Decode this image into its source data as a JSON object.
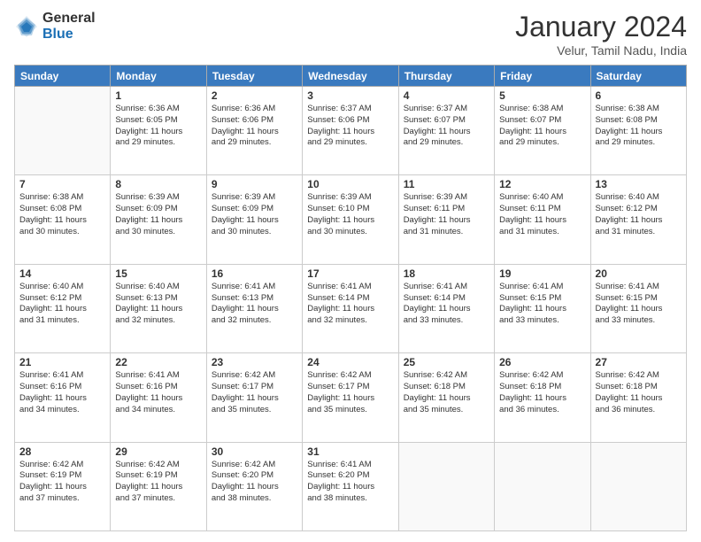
{
  "logo": {
    "general": "General",
    "blue": "Blue"
  },
  "title": "January 2024",
  "subtitle": "Velur, Tamil Nadu, India",
  "weekdays": [
    "Sunday",
    "Monday",
    "Tuesday",
    "Wednesday",
    "Thursday",
    "Friday",
    "Saturday"
  ],
  "weeks": [
    [
      {
        "day": "",
        "info": ""
      },
      {
        "day": "1",
        "info": "Sunrise: 6:36 AM\nSunset: 6:05 PM\nDaylight: 11 hours\nand 29 minutes."
      },
      {
        "day": "2",
        "info": "Sunrise: 6:36 AM\nSunset: 6:06 PM\nDaylight: 11 hours\nand 29 minutes."
      },
      {
        "day": "3",
        "info": "Sunrise: 6:37 AM\nSunset: 6:06 PM\nDaylight: 11 hours\nand 29 minutes."
      },
      {
        "day": "4",
        "info": "Sunrise: 6:37 AM\nSunset: 6:07 PM\nDaylight: 11 hours\nand 29 minutes."
      },
      {
        "day": "5",
        "info": "Sunrise: 6:38 AM\nSunset: 6:07 PM\nDaylight: 11 hours\nand 29 minutes."
      },
      {
        "day": "6",
        "info": "Sunrise: 6:38 AM\nSunset: 6:08 PM\nDaylight: 11 hours\nand 29 minutes."
      }
    ],
    [
      {
        "day": "7",
        "info": "Sunrise: 6:38 AM\nSunset: 6:08 PM\nDaylight: 11 hours\nand 30 minutes."
      },
      {
        "day": "8",
        "info": "Sunrise: 6:39 AM\nSunset: 6:09 PM\nDaylight: 11 hours\nand 30 minutes."
      },
      {
        "day": "9",
        "info": "Sunrise: 6:39 AM\nSunset: 6:09 PM\nDaylight: 11 hours\nand 30 minutes."
      },
      {
        "day": "10",
        "info": "Sunrise: 6:39 AM\nSunset: 6:10 PM\nDaylight: 11 hours\nand 30 minutes."
      },
      {
        "day": "11",
        "info": "Sunrise: 6:39 AM\nSunset: 6:11 PM\nDaylight: 11 hours\nand 31 minutes."
      },
      {
        "day": "12",
        "info": "Sunrise: 6:40 AM\nSunset: 6:11 PM\nDaylight: 11 hours\nand 31 minutes."
      },
      {
        "day": "13",
        "info": "Sunrise: 6:40 AM\nSunset: 6:12 PM\nDaylight: 11 hours\nand 31 minutes."
      }
    ],
    [
      {
        "day": "14",
        "info": "Sunrise: 6:40 AM\nSunset: 6:12 PM\nDaylight: 11 hours\nand 31 minutes."
      },
      {
        "day": "15",
        "info": "Sunrise: 6:40 AM\nSunset: 6:13 PM\nDaylight: 11 hours\nand 32 minutes."
      },
      {
        "day": "16",
        "info": "Sunrise: 6:41 AM\nSunset: 6:13 PM\nDaylight: 11 hours\nand 32 minutes."
      },
      {
        "day": "17",
        "info": "Sunrise: 6:41 AM\nSunset: 6:14 PM\nDaylight: 11 hours\nand 32 minutes."
      },
      {
        "day": "18",
        "info": "Sunrise: 6:41 AM\nSunset: 6:14 PM\nDaylight: 11 hours\nand 33 minutes."
      },
      {
        "day": "19",
        "info": "Sunrise: 6:41 AM\nSunset: 6:15 PM\nDaylight: 11 hours\nand 33 minutes."
      },
      {
        "day": "20",
        "info": "Sunrise: 6:41 AM\nSunset: 6:15 PM\nDaylight: 11 hours\nand 33 minutes."
      }
    ],
    [
      {
        "day": "21",
        "info": "Sunrise: 6:41 AM\nSunset: 6:16 PM\nDaylight: 11 hours\nand 34 minutes."
      },
      {
        "day": "22",
        "info": "Sunrise: 6:41 AM\nSunset: 6:16 PM\nDaylight: 11 hours\nand 34 minutes."
      },
      {
        "day": "23",
        "info": "Sunrise: 6:42 AM\nSunset: 6:17 PM\nDaylight: 11 hours\nand 35 minutes."
      },
      {
        "day": "24",
        "info": "Sunrise: 6:42 AM\nSunset: 6:17 PM\nDaylight: 11 hours\nand 35 minutes."
      },
      {
        "day": "25",
        "info": "Sunrise: 6:42 AM\nSunset: 6:18 PM\nDaylight: 11 hours\nand 35 minutes."
      },
      {
        "day": "26",
        "info": "Sunrise: 6:42 AM\nSunset: 6:18 PM\nDaylight: 11 hours\nand 36 minutes."
      },
      {
        "day": "27",
        "info": "Sunrise: 6:42 AM\nSunset: 6:18 PM\nDaylight: 11 hours\nand 36 minutes."
      }
    ],
    [
      {
        "day": "28",
        "info": "Sunrise: 6:42 AM\nSunset: 6:19 PM\nDaylight: 11 hours\nand 37 minutes."
      },
      {
        "day": "29",
        "info": "Sunrise: 6:42 AM\nSunset: 6:19 PM\nDaylight: 11 hours\nand 37 minutes."
      },
      {
        "day": "30",
        "info": "Sunrise: 6:42 AM\nSunset: 6:20 PM\nDaylight: 11 hours\nand 38 minutes."
      },
      {
        "day": "31",
        "info": "Sunrise: 6:41 AM\nSunset: 6:20 PM\nDaylight: 11 hours\nand 38 minutes."
      },
      {
        "day": "",
        "info": ""
      },
      {
        "day": "",
        "info": ""
      },
      {
        "day": "",
        "info": ""
      }
    ]
  ]
}
